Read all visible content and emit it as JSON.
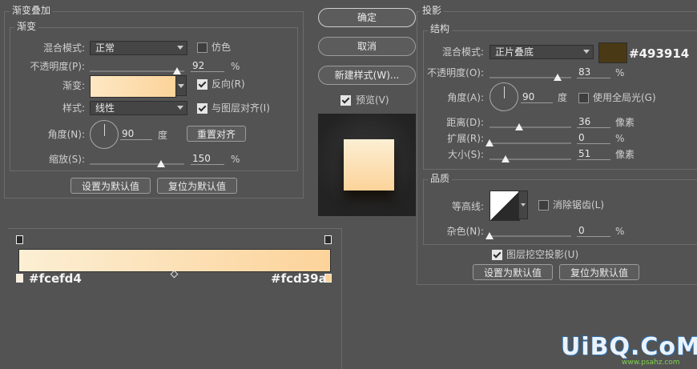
{
  "gradient_overlay": {
    "section_title": "渐变叠加",
    "group_title": "渐变",
    "blend_mode_label": "混合模式:",
    "blend_mode_value": "正常",
    "dither_label": "仿色",
    "opacity_label": "不透明度(P):",
    "opacity_value": "92",
    "opacity_fraction": 0.92,
    "percent": "%",
    "gradient_label": "渐变:",
    "reverse_label": "反向(R)",
    "style_label": "样式:",
    "style_value": "线性",
    "align_label": "与图层对齐(I)",
    "angle_label": "角度(N):",
    "angle_value": "90",
    "degree_unit": "度",
    "reset_align_button": "重置对齐",
    "scale_label": "缩放(S):",
    "scale_value": "150",
    "scale_fraction": 0.75,
    "set_default_button": "设置为默认值",
    "reset_default_button": "复位为默认值"
  },
  "gradient_editor": {
    "left_color_hex": "#fcefd4",
    "right_color_hex": "#fcd39a",
    "start_color": "#fcefd4",
    "end_color": "#fcd39a"
  },
  "buttons": {
    "ok": "确定",
    "cancel": "取消",
    "new_style": "新建样式(W)...",
    "preview_label": "预览(V)"
  },
  "drop_shadow": {
    "section_title": "投影",
    "group_title": "结构",
    "blend_mode_label": "混合模式:",
    "blend_mode_value": "正片叠底",
    "shadow_color": "#493914",
    "shadow_color_hex": "#493914",
    "opacity_label": "不透明度(O):",
    "opacity_value": "83",
    "opacity_fraction": 0.83,
    "percent": "%",
    "angle_label": "角度(A):",
    "angle_value": "90",
    "degree_unit": "度",
    "global_light_label": "使用全局光(G)",
    "distance_label": "距离(D):",
    "distance_value": "36",
    "distance_fraction": 0.36,
    "spread_label": "扩展(R):",
    "spread_value": "0",
    "spread_fraction": 0.0,
    "size_label": "大小(S):",
    "size_value": "51",
    "size_fraction": 0.2,
    "pixel_unit": "像素",
    "quality_title": "品质",
    "contour_label": "等高线:",
    "anti_alias_label": "消除锯齿(L)",
    "noise_label": "杂色(N):",
    "noise_value": "0",
    "noise_fraction": 0.0,
    "knockout_label": "图层挖空投影(U)",
    "set_default_button": "设置为默认值",
    "reset_default_button": "复位为默认值"
  },
  "watermark": {
    "main": "UiBQ.CoM",
    "sub": "www.psahz.com"
  }
}
